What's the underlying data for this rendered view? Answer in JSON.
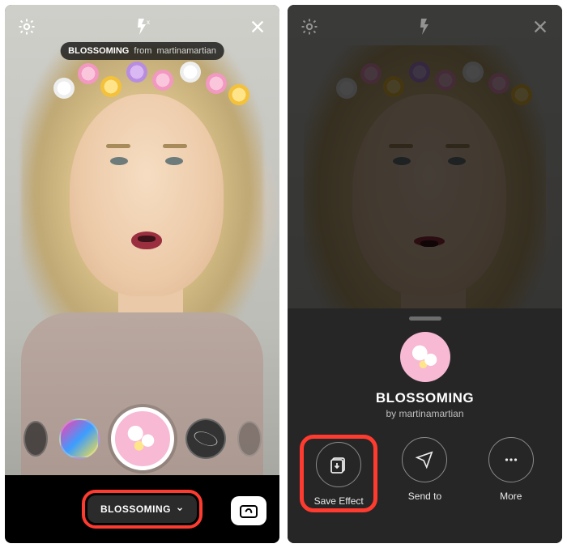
{
  "left": {
    "filter_pill": {
      "name": "BLOSSOMING",
      "from_word": "from",
      "author": "martinamartian"
    },
    "effect_chip_label": "BLOSSOMING",
    "icons": {
      "gear": "gear-icon",
      "flash": "flash-off-icon",
      "close": "close-icon",
      "camswap": "camera-switch-icon",
      "chevron": "chevron-down-icon"
    }
  },
  "right": {
    "sheet": {
      "title": "BLOSSOMING",
      "by_word": "by",
      "author": "martinamartian",
      "actions": {
        "save": {
          "label": "Save Effect"
        },
        "send": {
          "label": "Send to"
        },
        "more": {
          "label": "More"
        }
      }
    }
  },
  "highlight_color": "#ff3b30"
}
